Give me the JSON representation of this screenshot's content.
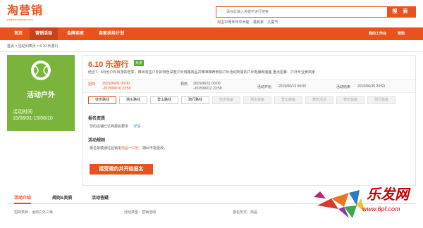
{
  "logo": {
    "cn": "淘营销",
    "en": "yingxiao.taobao.com"
  },
  "search": {
    "placeholder": "请在此输入关键字进行搜索",
    "button": "搜 索"
  },
  "hotwords": [
    "淘宝12周年年中大促",
    "极有家",
    "儿童节"
  ],
  "nav": {
    "items": [
      "首页",
      "营销活动",
      "金牌卖家",
      "卖家扶持计划"
    ],
    "workbench": "我的工作台",
    "help": "帮助"
  },
  "breadcrumb": "首页 > 活动列表页 > 6.10 乐游行",
  "card": {
    "category": "活动户外",
    "time_label": "活动时间",
    "time_value": "15/06/01-15/06/10"
  },
  "activity": {
    "title": "6.10 乐游行",
    "badge": "免费",
    "description": "结合7、8月份户外出游的旺季，推出淘宝户外的特色深度户外线路商品并精准推荐参加户外活动所需的户外鞋服和装备 重点招募：户外专业卖商家",
    "signup_label": "招商",
    "signup_start": "2015/06/01 00:00",
    "signup_end": "-2015/06/10 23:59",
    "preview_label": "预热",
    "preview_start": "2015/06/11 00:00",
    "preview_end": "-2015/06/12 23:59",
    "start_label": "活动开始",
    "start_value": "2015/06/13 00:00",
    "end_label": "活动结束",
    "end_value": "2015/06/25 23:59"
  },
  "routes": [
    {
      "label": "徒步路线",
      "state": "selected"
    },
    {
      "label": "溯水路线",
      "state": "normal"
    },
    {
      "label": "登山路线",
      "state": "normal"
    },
    {
      "label": "骑行路线",
      "state": "normal"
    },
    {
      "label": "徒步装备",
      "state": "disabled"
    },
    {
      "label": "溯水装备",
      "state": "disabled"
    },
    {
      "label": "登山装备",
      "state": "disabled"
    },
    {
      "label": "攀岩活动",
      "state": "disabled"
    },
    {
      "label": "攀岩装备",
      "state": "disabled"
    },
    {
      "label": "骑行装备",
      "state": "disabled"
    }
  ],
  "qualification": {
    "title": "报名资质",
    "text": "您的店铺已达到报名要求",
    "link": "详情"
  },
  "rules": {
    "title": "活动规则",
    "prefix": "报名单模通过后锁定",
    "highlight": "商品一口价",
    "suffix": "，期间不能更改。"
  },
  "cta": "接受邀约并开始报名",
  "bottom_tabs": [
    "活动介绍",
    "规则&资质",
    "活动答疑"
  ],
  "meta": [
    {
      "label": "招商类目：",
      "value": "运动户外三级"
    },
    {
      "label": "活动类型：",
      "value": "营销活动"
    },
    {
      "label": "报名形式：",
      "value": "商品"
    }
  ],
  "watermark": {
    "text": "乐发网",
    "url": "www.6pf.com"
  },
  "colors": {
    "accent": "#e8531d",
    "green": "#7ab43c",
    "link": "#3a7fc4"
  }
}
